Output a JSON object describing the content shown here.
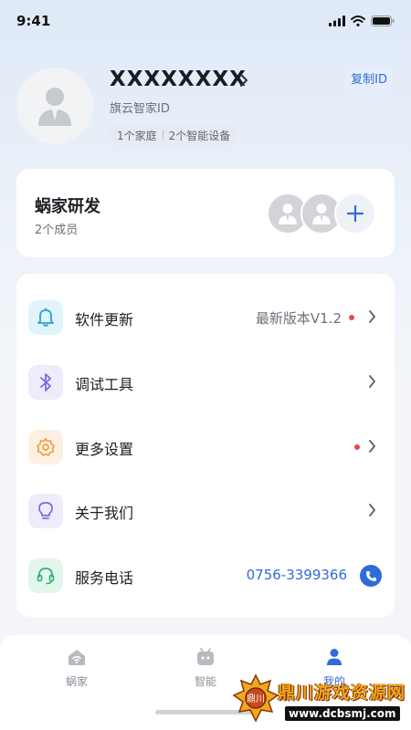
{
  "status": {
    "time": "9:41"
  },
  "profile": {
    "name": "XXXXXXXX",
    "id_label": "旗云智家ID",
    "copy_label": "复制ID",
    "tag_family": "1个家庭",
    "tag_devices": "2个智能设备"
  },
  "family": {
    "name": "蜗家研发",
    "member_count": "2个成员"
  },
  "menu": [
    {
      "label": "软件更新",
      "value": "最新版本V1.2",
      "icon": "bell-icon",
      "has_dot": true
    },
    {
      "label": "调试工具",
      "value": "",
      "icon": "bluetooth-icon",
      "has_dot": false
    },
    {
      "label": "更多设置",
      "value": "",
      "icon": "gear-icon",
      "has_dot": true
    },
    {
      "label": "关于我们",
      "value": "",
      "icon": "lightbulb-icon",
      "has_dot": false
    },
    {
      "label": "服务电话",
      "value": "0756-3399366",
      "icon": "headset-icon",
      "has_dot": false
    }
  ],
  "tabs": [
    {
      "label": "蜗家",
      "icon": "home-wifi-icon",
      "active": false
    },
    {
      "label": "智能",
      "icon": "robot-icon",
      "active": false
    },
    {
      "label": "我的",
      "icon": "person-icon",
      "active": true
    }
  ],
  "watermark": {
    "title": "鼎川游戏资源网",
    "url": "www.dcbsmj.com",
    "badge_text": "鼎川"
  },
  "colors": {
    "accent": "#2f6bd8",
    "dot": "#e5484d"
  }
}
